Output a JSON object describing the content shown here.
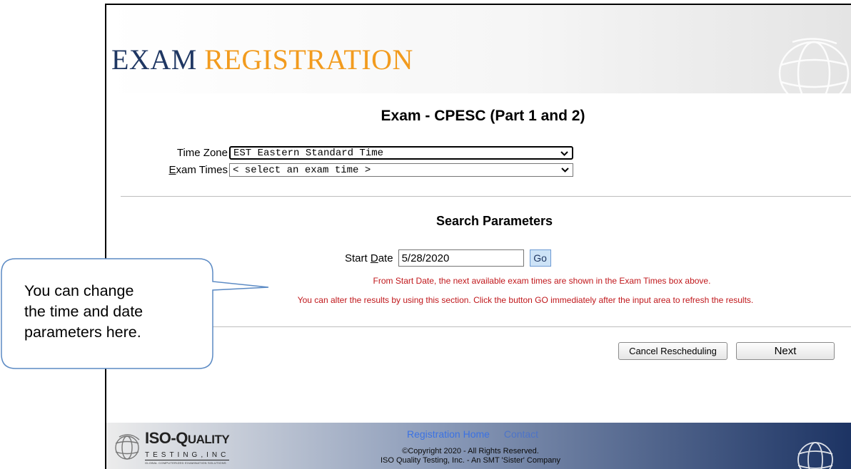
{
  "header": {
    "logo_word1": "EXAM",
    "logo_word2": "REGISTRATION",
    "brand_colors": {
      "navy": "#1f3763",
      "orange": "#f29b1e"
    },
    "decor_icon": "globe-icon"
  },
  "page": {
    "title": "Exam - CPESC (Part 1 and 2)"
  },
  "form": {
    "time_zone_label": "Time Zone",
    "time_zone_value": "EST Eastern Standard Time",
    "exam_times_label_first": "E",
    "exam_times_label_rest": "xam Times",
    "exam_times_value": "< select an exam time >"
  },
  "search": {
    "title": "Search Parameters",
    "start_label_pre": "Start ",
    "start_label_underlined": "D",
    "start_label_post": "ate",
    "start_date_value": "5/28/2020",
    "go_label": "Go",
    "info_line1": "From Start Date, the next available exam times are shown in the Exam Times box above.",
    "info_line2": "You can alter the results by using this section. Click the button GO immediately after the input area to refresh the results.",
    "info_color": "#c0171b"
  },
  "actions": {
    "cancel_label": "Cancel Rescheduling",
    "next_label": "Next"
  },
  "footer": {
    "brand_main_prefix": "ISO-",
    "brand_main_q": "Q",
    "brand_main_rest": "UALITY",
    "brand_sub": "TESTING,INC",
    "brand_tag": "GLOBAL COMPUTERIZED EXAMINATION SOLUTIONS",
    "link_home": "Registration Home",
    "link_contact": "Contact",
    "copyright_line1": "©Copyright 2020 - All Rights Reserved.",
    "copyright_line2": "ISO Quality Testing, Inc. - An SMT 'Sister' Company"
  },
  "callout": {
    "line1": "You can change",
    "line2": "the time and date",
    "line3": "parameters here.",
    "border_color": "#5b8ac4"
  }
}
